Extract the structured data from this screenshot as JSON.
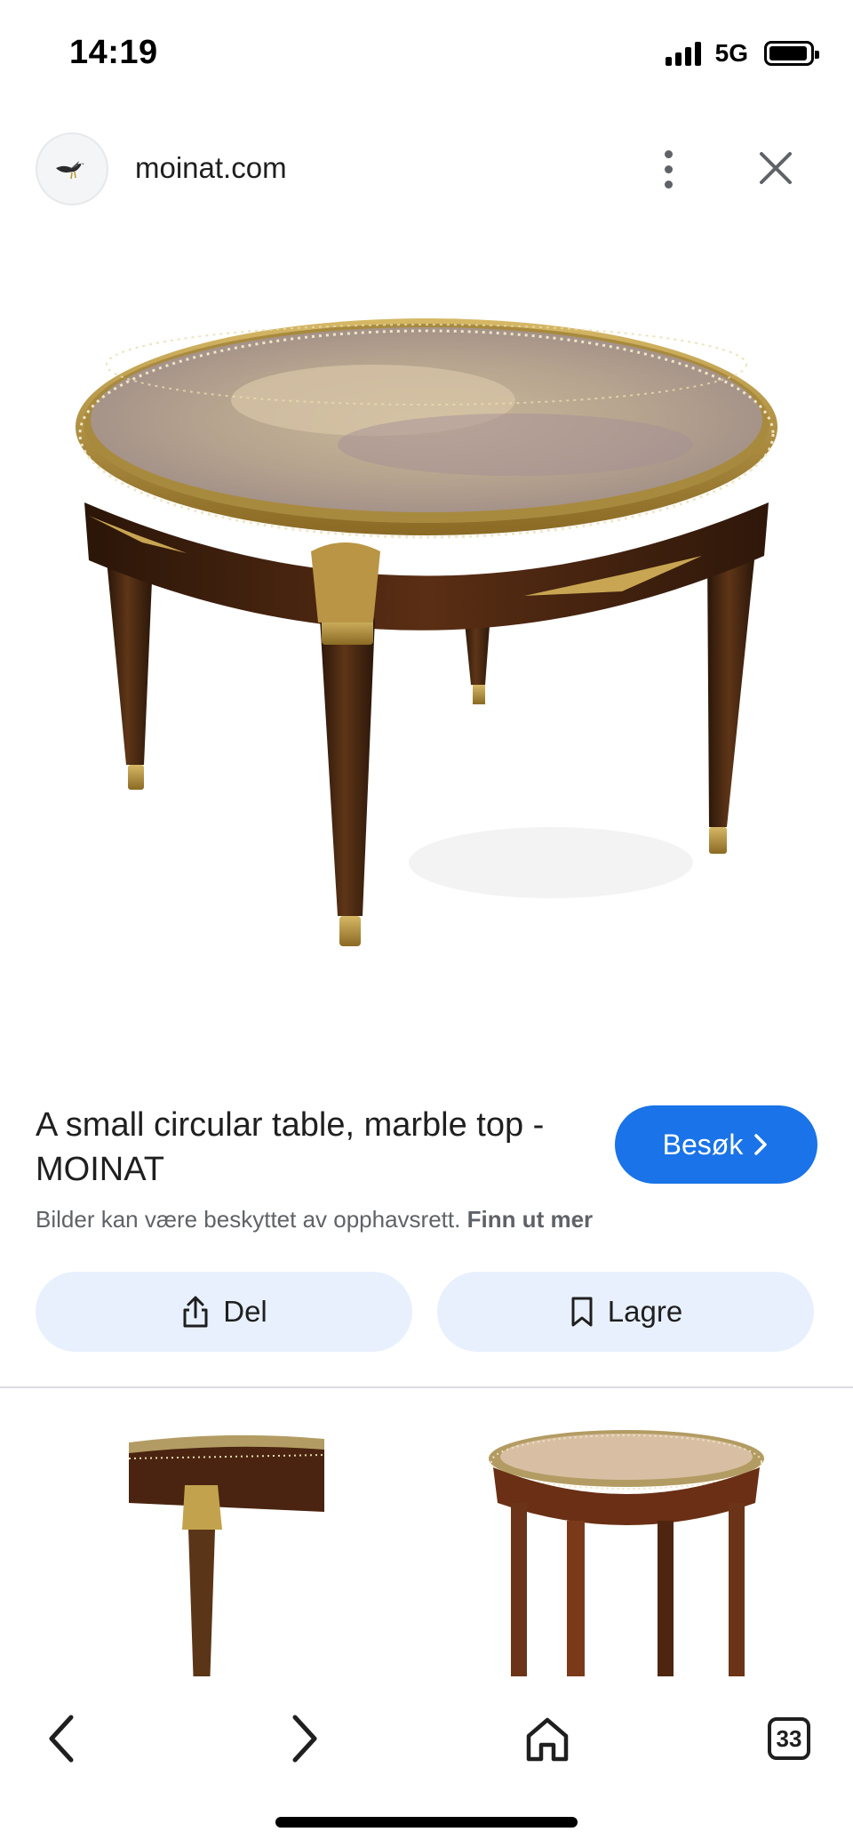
{
  "status_bar": {
    "time": "14:19",
    "network": "5G"
  },
  "header": {
    "site_name": "moinat.com",
    "logo_icon": "seagull-logo-icon",
    "more_icon": "more-vert-icon",
    "close_icon": "close-icon"
  },
  "result": {
    "title": "A small circular table, marble top - MOINAT",
    "visit_label": "Besøk",
    "copyright_text": "Bilder kan være beskyttet av opphavsrett.",
    "learn_more": "Finn ut mer"
  },
  "actions": {
    "share_label": "Del",
    "save_label": "Lagre"
  },
  "related": [
    {
      "name": "related-image-1",
      "icon": "table-image"
    },
    {
      "name": "related-image-2",
      "icon": "table-image"
    }
  ],
  "bottom_nav": {
    "tab_count": "33"
  },
  "colors": {
    "accent": "#1a73e8",
    "action_bg": "#e8f0fe",
    "muted_text": "#5f6368"
  }
}
